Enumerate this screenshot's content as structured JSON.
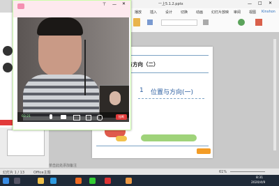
{
  "wps": {
    "tab_title": "一上5.1.2.pptx",
    "ribbon_items": [
      "播放",
      "插入",
      "设计",
      "切换",
      "动画",
      "幻灯片放映",
      "审阅",
      "视图"
    ],
    "right_label": "Kinshon"
  },
  "slide": {
    "title_top": "置与方向（二）",
    "subtitle": "位置与方向(一)",
    "subtitle_number": "1"
  },
  "status": {
    "page_info": "幻灯片 1 / 13",
    "notes_hint": "单击此处添加备注",
    "zoom": "61%",
    "theme": "Office主题"
  },
  "taskbar": {
    "time": "8:31",
    "date": "2020/4/9"
  },
  "video_window": {
    "hangup_label": "挂断",
    "duration": "03:21"
  },
  "colors": {
    "taskbar": "#1f2a38",
    "hangup": "#e23a3a",
    "title_pink": "#fde9ee",
    "slide_blue": "#7aa2c4"
  }
}
